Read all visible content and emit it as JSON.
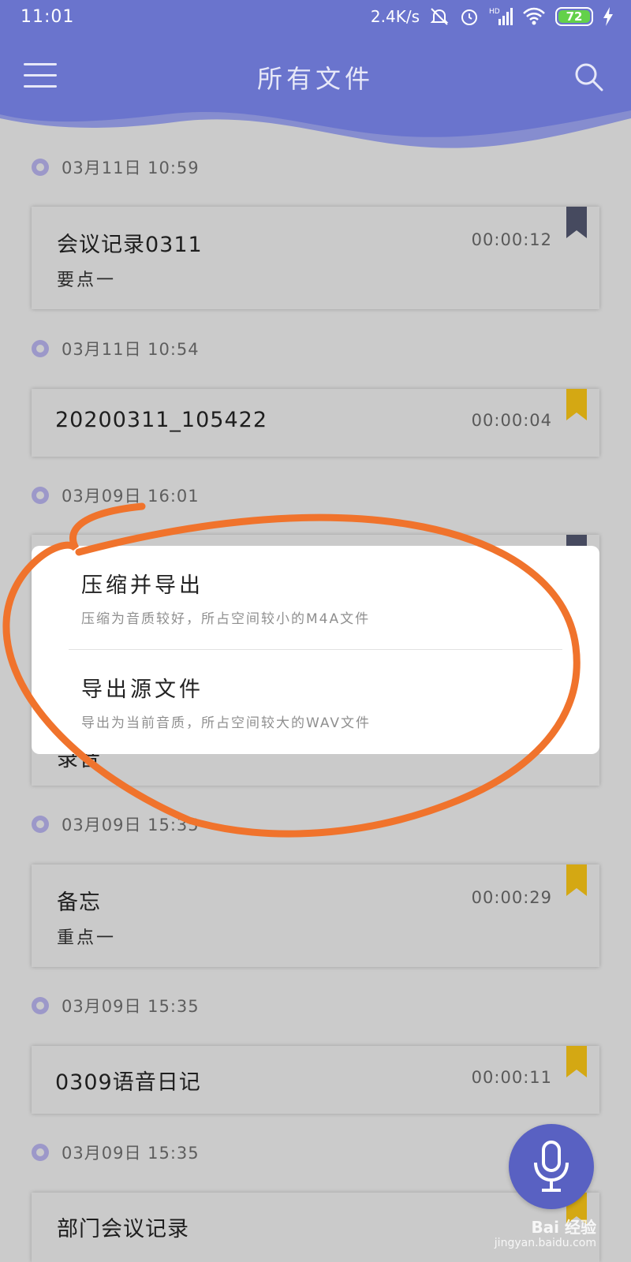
{
  "status_bar": {
    "time": "11:01",
    "net_speed": "2.4K/s",
    "battery": "72",
    "signal_label": "HD"
  },
  "header": {
    "title": "所有文件",
    "menu_icon": "hamburger-menu-icon",
    "search_icon": "search-icon"
  },
  "colors": {
    "header": "#6a74cd",
    "background": "#cbcbcb",
    "bookmark_dark": "#464a5f",
    "bookmark_gold": "#d4a813",
    "annotation": "#f0732c",
    "fab": "#5961c2"
  },
  "recordings": [
    {
      "date": "03月11日 10:59",
      "name": "会议记录0311",
      "note": "要点一",
      "duration": "00:00:12",
      "bookmark": "dark"
    },
    {
      "date": "03月11日 10:54",
      "name": "20200311_105422",
      "note": "",
      "duration": "00:00:04",
      "bookmark": "gold"
    },
    {
      "date": "03月09日 16:01",
      "name": "",
      "note": "",
      "duration": "",
      "bookmark": "dark"
    },
    {
      "date": "03月09日 15:35",
      "name": "备忘",
      "note": "重点一",
      "duration": "00:00:29",
      "bookmark": "gold"
    },
    {
      "date": "03月09日 15:35",
      "name": "0309语音日记",
      "note": "",
      "duration": "00:00:11",
      "bookmark": "gold"
    },
    {
      "date": "03月09日 15:35",
      "name": "部门会议记录",
      "note": "",
      "duration": "",
      "bookmark": "gold"
    }
  ],
  "partial_card_text": "录音",
  "popup": {
    "options": [
      {
        "title": "压缩并导出",
        "desc": "压缩为音质较好，所占空间较小的M4A文件"
      },
      {
        "title": "导出源文件",
        "desc": "导出为当前音质，所占空间较大的WAV文件"
      }
    ]
  },
  "fab": {
    "icon": "microphone-icon"
  },
  "watermark": {
    "brand": "Bai 经验",
    "url": "jingyan.baidu.com"
  }
}
